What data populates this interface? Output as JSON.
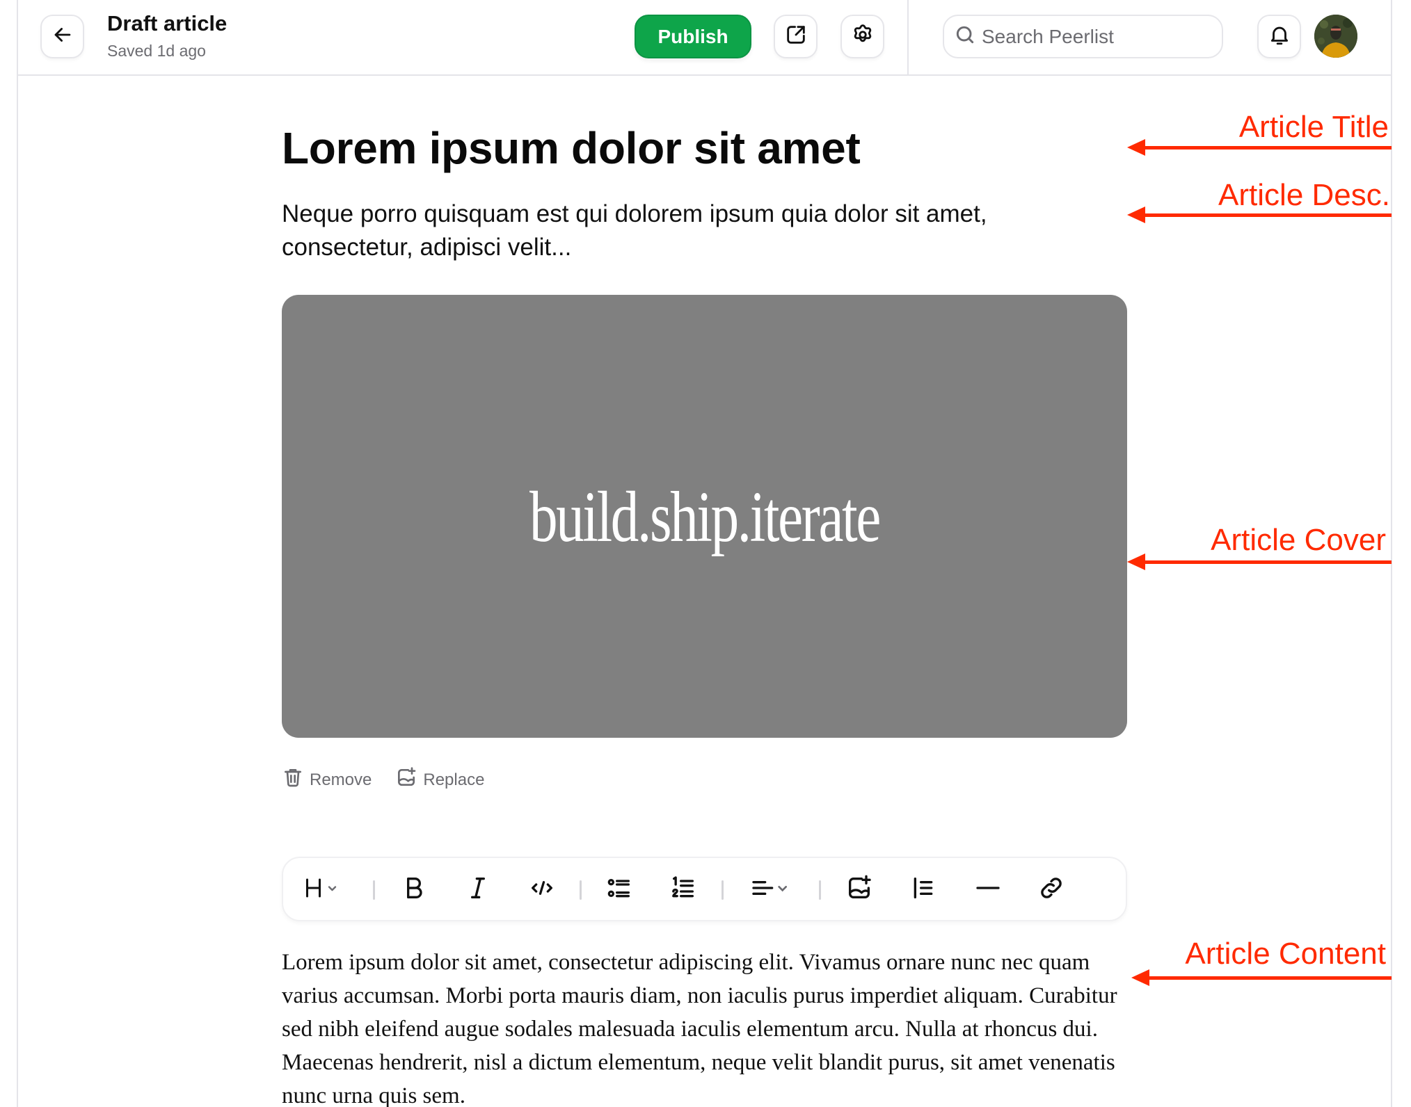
{
  "header": {
    "back_label": "Back",
    "title": "Draft article",
    "status": "Saved 1d ago",
    "publish_label": "Publish",
    "share_label": "Open preview",
    "settings_label": "Settings",
    "search": {
      "placeholder": "Search Peerlist",
      "value": ""
    },
    "notifications_label": "Notifications",
    "avatar_label": "User avatar"
  },
  "article": {
    "title": "Lorem ipsum dolor sit amet",
    "description": "Neque porro quisquam est qui dolorem ipsum quia dolor sit amet, consectetur, adipisci velit...",
    "cover_text": "build.ship.iterate",
    "cover_color": "#808080",
    "cover_actions": {
      "remove": "Remove",
      "replace": "Replace"
    },
    "body": "Lorem ipsum dolor sit amet, consectetur adipiscing elit. Vivamus ornare nunc nec quam varius accumsan. Morbi porta mauris diam, non iaculis purus imperdiet aliquam. Curabitur sed nibh eleifend augue sodales malesuada iaculis elementum arcu. Nulla at rhoncus dui. Maecenas hendrerit, nisl a dictum elementum, neque velit blandit purus, sit amet venenatis nunc urna quis sem."
  },
  "toolbar": {
    "items": [
      {
        "name": "heading",
        "icon": "heading-icon",
        "label": "H"
      },
      {
        "name": "bold",
        "icon": "bold-icon",
        "label": "B"
      },
      {
        "name": "italic",
        "icon": "italic-icon"
      },
      {
        "name": "code",
        "icon": "code-icon"
      },
      {
        "name": "bullet-list",
        "icon": "bullet-list-icon"
      },
      {
        "name": "numbered-list",
        "icon": "numbered-list-icon"
      },
      {
        "name": "align",
        "icon": "align-icon"
      },
      {
        "name": "image",
        "icon": "add-image-icon"
      },
      {
        "name": "blockquote",
        "icon": "blockquote-icon"
      },
      {
        "name": "divider",
        "icon": "horizontal-rule-icon"
      },
      {
        "name": "link",
        "icon": "link-icon"
      }
    ]
  },
  "annotations": [
    {
      "label": "Article Title"
    },
    {
      "label": "Article Desc."
    },
    {
      "label": "Article Cover"
    },
    {
      "label": "Article Content"
    }
  ],
  "colors": {
    "accent": "#0ea54a",
    "annotation": "#ff2a00",
    "muted_text": "#6b6b70",
    "border": "#e4e4e9"
  }
}
